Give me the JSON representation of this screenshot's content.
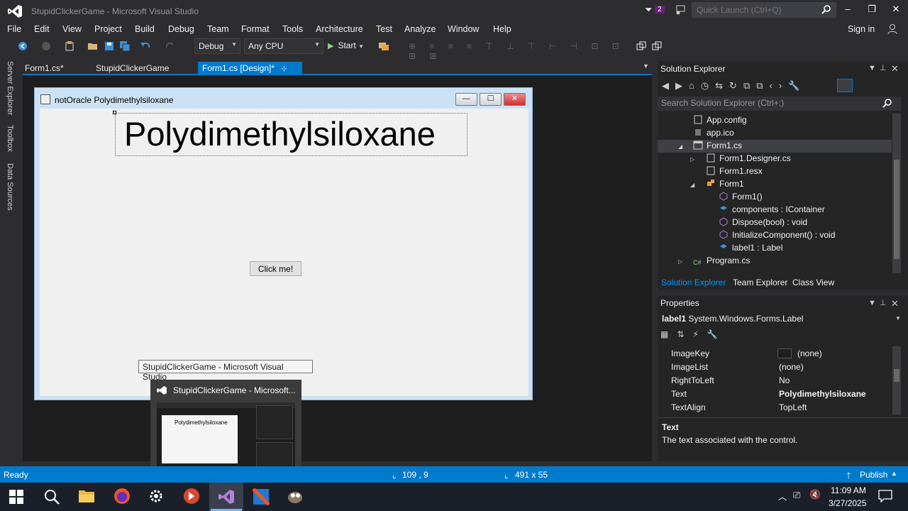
{
  "window": {
    "title": "StupidClickerGame - Microsoft Visual Studio",
    "notification_count": "2",
    "quick_launch_placeholder": "Quick Launch (Ctrl+Q)",
    "minimize": "–",
    "restore": "❐",
    "close": "✕"
  },
  "menu": {
    "items": [
      "File",
      "Edit",
      "View",
      "Project",
      "Build",
      "Debug",
      "Team",
      "Format",
      "Tools",
      "Architecture",
      "Test",
      "Analyze",
      "Window",
      "Help"
    ],
    "signin": "Sign in"
  },
  "toolbar": {
    "configuration": "Debug",
    "platform": "Any CPU",
    "start_label": "Start"
  },
  "side_tabs": [
    "Server Explorer",
    "Toolbox",
    "Data Sources"
  ],
  "doc_tabs": [
    {
      "label": "Form1.cs*"
    },
    {
      "label": "StupidClickerGame"
    },
    {
      "label": "Form1.cs [Design]*",
      "pin": "⊹",
      "close": "✕"
    }
  ],
  "form": {
    "title": "notOracle Polydimethylsiloxane",
    "label1_text": "Polydimethylsiloxane",
    "button_text": "Click me!",
    "min": "—",
    "max": "☐",
    "close": "✕"
  },
  "taskbar_preview": {
    "tooltip": "StupidClickerGame - Microsoft Visual Studio",
    "title": "StupidClickerGame - Microsoft...",
    "thumb_text": "Polydimethylsiloxane"
  },
  "solution_explorer": {
    "title": "Solution Explorer",
    "search_placeholder": "Search Solution Explorer (Ctrl+;)",
    "items": [
      {
        "label": "App.config"
      },
      {
        "label": "app.ico"
      },
      {
        "label": "Form1.cs"
      },
      {
        "label": "Form1.Designer.cs"
      },
      {
        "label": "Form1.resx"
      },
      {
        "label": "Form1"
      },
      {
        "label": "Form1()"
      },
      {
        "label": "components : IContainer"
      },
      {
        "label": "Dispose(bool) : void"
      },
      {
        "label": "InitializeComponent() : void"
      },
      {
        "label": "label1 : Label"
      },
      {
        "label": "Program.cs"
      }
    ],
    "tabs": [
      "Solution Explorer",
      "Team Explorer",
      "Class View"
    ]
  },
  "properties": {
    "title": "Properties",
    "object_name": "label1",
    "object_type": "System.Windows.Forms.Label",
    "rows": [
      {
        "name": "ImageKey",
        "value": "(none)"
      },
      {
        "name": "ImageList",
        "value": "(none)"
      },
      {
        "name": "RightToLeft",
        "value": "No"
      },
      {
        "name": "Text",
        "value": "Polydimethylsiloxane"
      },
      {
        "name": "TextAlign",
        "value": "TopLeft"
      }
    ],
    "desc_title": "Text",
    "desc": "The text associated with the control."
  },
  "status": {
    "ready": "Ready",
    "position": "109 , 9",
    "size": "491 x 55",
    "publish": "Publish"
  },
  "clock": {
    "time": "11:09 AM",
    "date": "3/27/2025"
  },
  "colors": {
    "accent": "#007acc",
    "background": "#2d2d30"
  }
}
